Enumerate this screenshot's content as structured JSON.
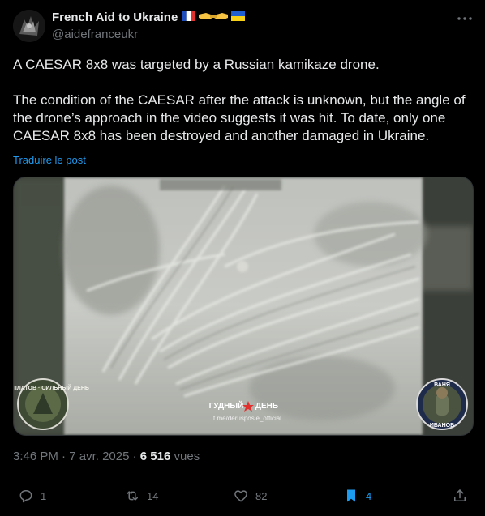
{
  "post": {
    "author": {
      "name": "French Aid to Ukraine",
      "handle": "@aidefranceukr",
      "emoji_flags": [
        "flag-france-icon",
        "handshake-icon",
        "flag-ukraine-icon"
      ]
    },
    "text": {
      "paragraph1": "A CAESAR 8x8 was targeted by a Russian kamikaze drone.",
      "paragraph2": "The condition of the CAESAR after the attack is unknown, but the angle of the drone’s approach in the video suggests it was hit. To date, only one CAESAR 8x8 has been destroyed and another damaged in Ukraine."
    },
    "translate_label": "Traduire le post",
    "media": {
      "watermark_left": "ЕВРОПЛАТОВ · СИЛЬНЫЙ ДЕНЬ",
      "watermark_center_1": "ГУДНЫЙ",
      "watermark_center_2": "ДЕНЬ",
      "watermark_center_sub": "t.me/derusposle_official",
      "watermark_right_top": "ВАНЯ",
      "watermark_right_bottom": "ИВАНОВ"
    },
    "meta": {
      "time": "3:46 PM",
      "separator1": "·",
      "date": "7 avr. 2025",
      "separator2": "·",
      "views_count": "6 516",
      "views_label": "vues"
    },
    "actions": {
      "replies": "1",
      "reposts": "14",
      "likes": "82",
      "bookmarks": "4"
    },
    "colors": {
      "background": "#000000",
      "text": "#e7e9ea",
      "muted": "#71767b",
      "accent": "#1d9bf0"
    }
  }
}
